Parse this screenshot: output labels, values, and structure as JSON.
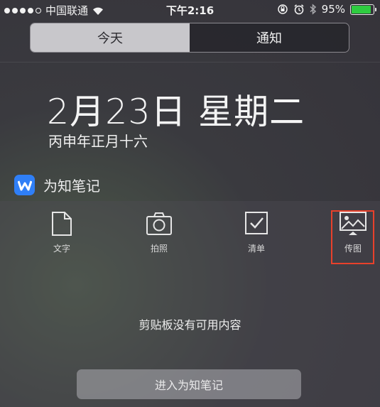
{
  "status_bar": {
    "carrier": "中国联通",
    "time": "下午2:16",
    "battery_percent": "95%",
    "battery_level": 0.95,
    "signal_bars": 4
  },
  "segmented": {
    "today_label": "今天",
    "notifications_label": "通知"
  },
  "date": {
    "main": "2月23日 星期二",
    "lunar": "丙申年正月十六"
  },
  "widget": {
    "app_name": "为知笔记",
    "actions": [
      {
        "label": "文字",
        "icon": "document-icon"
      },
      {
        "label": "拍照",
        "icon": "camera-icon"
      },
      {
        "label": "清单",
        "icon": "checklist-icon"
      },
      {
        "label": "传图",
        "icon": "image-upload-icon"
      }
    ],
    "empty_message": "剪贴板没有可用内容",
    "open_button": "进入为知笔记"
  },
  "colors": {
    "app_blue": "#2f7ff7",
    "highlight_red": "#e8412b",
    "battery_green": "#2ecc40"
  }
}
